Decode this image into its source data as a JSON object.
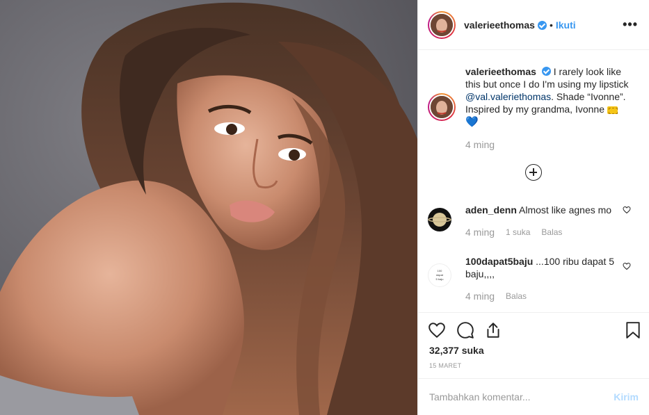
{
  "post": {
    "image_alt": "portrait photo"
  },
  "header": {
    "username": "valerieethomas",
    "dot": "•",
    "follow_label": "Ikuti",
    "more_label": "•••"
  },
  "caption": {
    "username": "valerieethomas",
    "text_before": "I rarely look like this but once I do I'm using my lipstick",
    "mention": "@val.valeriethomas",
    "text_after": ". Shade “Ivonne”. Inspired by my grandma, Ivonne",
    "emoji_1": "ticket-icon",
    "emoji_2": "💙",
    "time": "4 ming"
  },
  "load_more": {
    "icon": "plus-circle-icon"
  },
  "comments": [
    {
      "username": "aden_denn",
      "text": "Almost like agnes mo",
      "time": "4 ming",
      "likes": "1 suka",
      "reply": "Balas"
    },
    {
      "username": "100dapat5baju",
      "text": "...100 ribu dapat 5 baju,,,,",
      "time": "4 ming",
      "reply": "Balas",
      "avatar_text": [
        "100",
        "dapat",
        "5 baju"
      ]
    }
  ],
  "actions": {
    "like_icon": "heart-icon",
    "comment_icon": "comment-icon",
    "share_icon": "share-icon",
    "save_icon": "bookmark-icon"
  },
  "likes_count": "32,377 suka",
  "date": "15 MARET",
  "comment_input": {
    "placeholder": "Tambahkan komentar...",
    "send_label": "Kirim"
  },
  "colors": {
    "accent": "#3897f0",
    "text": "#262626",
    "muted": "#999999",
    "border": "#efefef"
  }
}
